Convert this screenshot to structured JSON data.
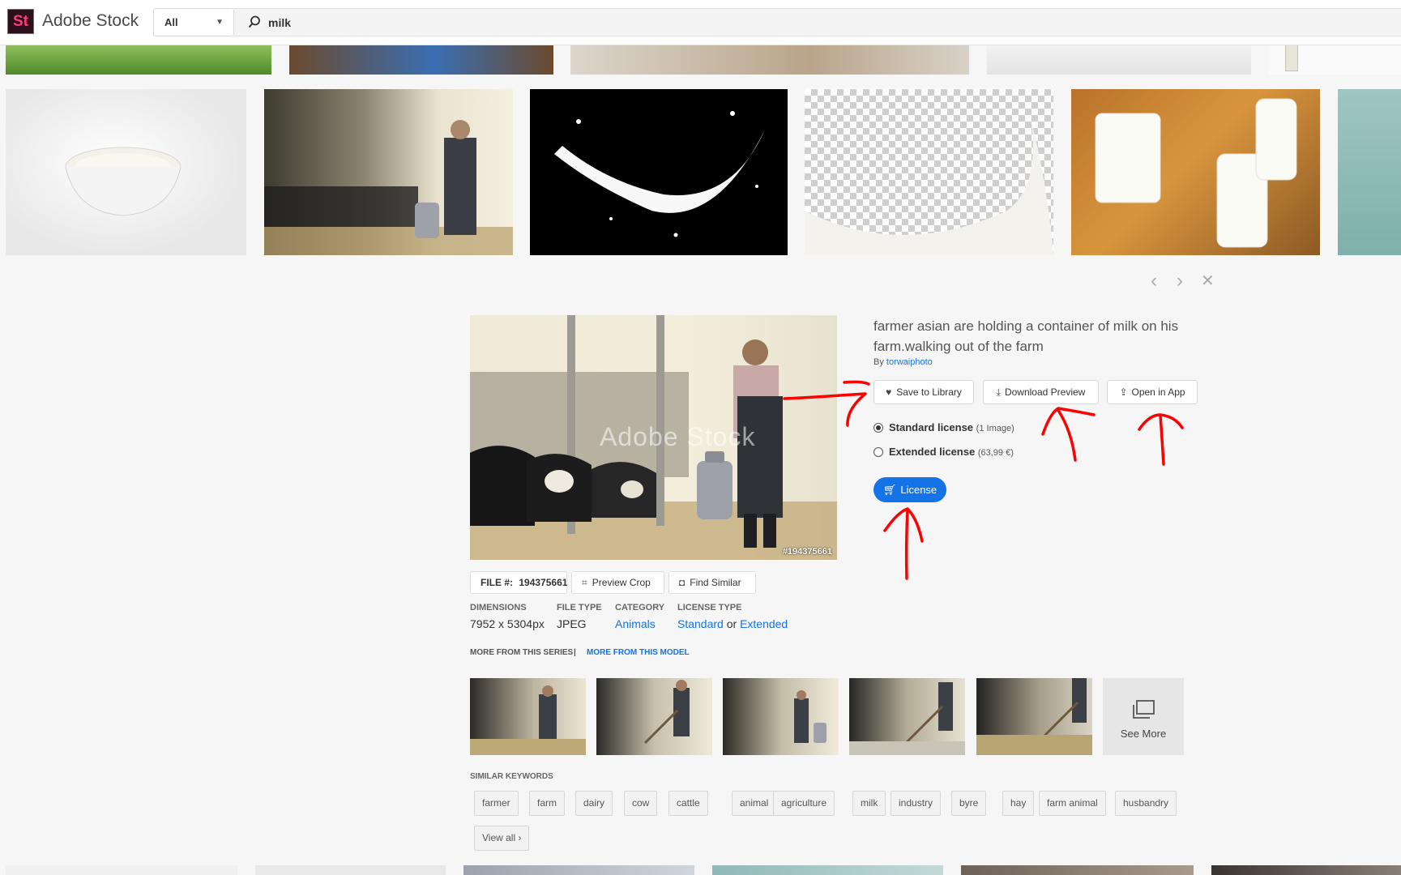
{
  "brand": {
    "logo_letters": "St",
    "name": "Adobe Stock"
  },
  "search": {
    "filter_value": "All",
    "query": "milk"
  },
  "colors": {
    "accent": "#1473e6",
    "annotation": "#ff0000",
    "logo_pink": "#ff3b7a"
  },
  "nav": {
    "prev_icon": "‹",
    "next_icon": "›",
    "close_icon": "✕"
  },
  "preview": {
    "watermark": "Adobe Stock",
    "file_id_overlay": "#194375661"
  },
  "file_bar": {
    "file_label": "FILE #:",
    "file_number": "194375661",
    "preview_crop": "Preview Crop",
    "find_similar": "Find Similar"
  },
  "meta": {
    "dimensions_label": "DIMENSIONS",
    "dimensions_value": "7952 x 5304px",
    "file_type_label": "FILE TYPE",
    "file_type_value": "JPEG",
    "category_label": "CATEGORY",
    "category_value": "Animals",
    "license_type_label": "LICENSE TYPE",
    "license_standard": "Standard",
    "license_or": "or",
    "license_extended": "Extended"
  },
  "series": {
    "more_series": "MORE FROM THIS SERIES",
    "separator": "|",
    "more_model": "MORE FROM THIS MODEL",
    "see_more": "See More"
  },
  "keywords": {
    "title": "SIMILAR KEYWORDS",
    "items": [
      "farmer",
      "farm",
      "dairy",
      "cow",
      "cattle",
      "animal",
      "agriculture",
      "milk",
      "industry",
      "byre",
      "hay",
      "farm animal",
      "husbandry"
    ],
    "view_all": "View all ›"
  },
  "asset": {
    "title": "farmer asian are holding a container of milk on his farm.walking out of the farm",
    "by_label": "By",
    "author": "torwaiphoto"
  },
  "actions": {
    "save": "Save to Library",
    "download": "Download Preview",
    "open": "Open in App"
  },
  "licenses": {
    "standard_label": "Standard license",
    "standard_sub": "(1 Image)",
    "extended_label": "Extended license",
    "extended_sub": "(63,99 €)",
    "selected": "standard",
    "button": "License"
  }
}
